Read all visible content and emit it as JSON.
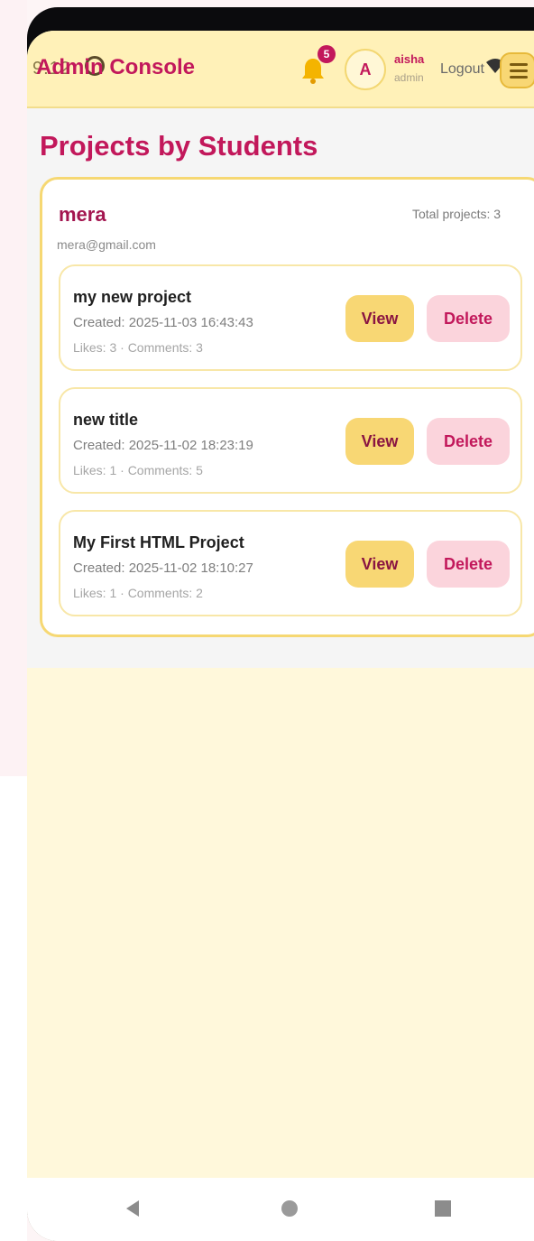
{
  "status_bar": {
    "time": "9:12"
  },
  "header": {
    "brand": "Admin Console",
    "notifications_count": "5",
    "avatar_initial": "A",
    "user_name": "aisha",
    "user_role": "admin",
    "logout_label": "Logout"
  },
  "page": {
    "title": "Projects by Students"
  },
  "student": {
    "name": "mera",
    "email": "mera@gmail.com",
    "total_projects": "Total projects: 3",
    "projects": [
      {
        "title": "my new project",
        "created": "Created: 2025-11-03 16:43:43",
        "stats": "Likes: 3 · Comments: 3",
        "view_label": "View",
        "delete_label": "Delete"
      },
      {
        "title": "new title",
        "created": "Created: 2025-11-02 18:23:19",
        "stats": "Likes: 1 · Comments: 5",
        "view_label": "View",
        "delete_label": "Delete"
      },
      {
        "title": "My First HTML Project",
        "created": "Created: 2025-11-02 18:10:27",
        "stats": "Likes: 1 · Comments: 2",
        "view_label": "View",
        "delete_label": "Delete"
      }
    ]
  },
  "colors": {
    "brand": "#c2185b",
    "header_bg": "#fff1b8",
    "view_button": "#f8d774",
    "delete_button": "#fbd4dc"
  },
  "icons": [
    "bell-icon",
    "wifi-icon",
    "menu-icon",
    "back-icon",
    "home-icon",
    "recents-icon"
  ]
}
